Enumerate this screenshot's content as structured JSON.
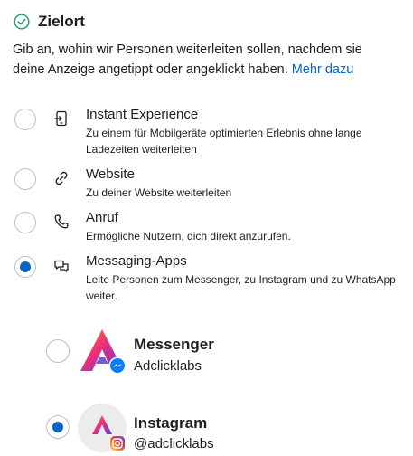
{
  "section": {
    "title": "Zielort",
    "description": "Gib an, wohin wir Personen weiterleiten sollen, nachdem sie deine Anzeige angetippt oder angeklickt haben.",
    "learn_more": "Mehr dazu",
    "title_icon": "check-circle-icon"
  },
  "options": [
    {
      "title": "Instant Experience",
      "subtitle": "Zu einem für Mobilgeräte optimierten Erlebnis ohne lange Ladezeiten weiterleiten",
      "icon": "phone-screen-icon",
      "selected": false
    },
    {
      "title": "Website",
      "subtitle": "Zu deiner Website weiterleiten",
      "icon": "link-icon",
      "selected": false
    },
    {
      "title": "Anruf",
      "subtitle": "Ermögliche Nutzern, dich direkt anzurufen.",
      "icon": "phone-icon",
      "selected": false
    },
    {
      "title": "Messaging-Apps",
      "subtitle": "Leite Personen zum Messenger, zu Instagram und zu WhatsApp weiter.",
      "icon": "chat-bubbles-icon",
      "selected": true
    }
  ],
  "accounts": [
    {
      "app": "Messenger",
      "account": "Adclicklabs",
      "badge": "messenger-badge-icon",
      "selected": false
    },
    {
      "app": "Instagram",
      "account": "@adclicklabs",
      "badge": "instagram-badge-icon",
      "selected": true
    }
  ],
  "colors": {
    "accent": "#0a66c2",
    "link": "#0064d1",
    "success": "#1f9e6e"
  }
}
